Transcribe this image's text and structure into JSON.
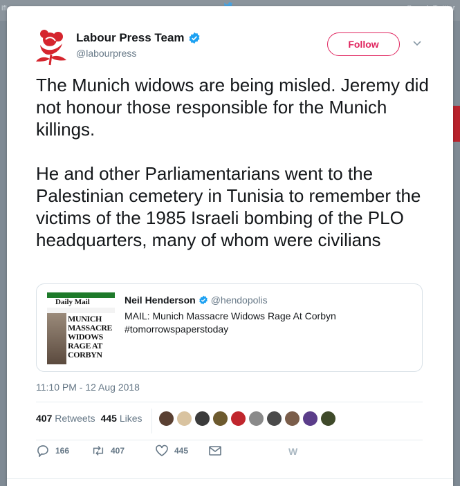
{
  "topbar": {
    "left_text": "ifi",
    "right_text": "Search Twitter"
  },
  "author": {
    "name": "Labour Press Team",
    "handle": "@labourpress"
  },
  "follow_label": "Follow",
  "tweet": {
    "paragraph1": "The Munich widows are being misled. Jeremy did not honour those responsible for the Munich killings.",
    "paragraph2": "He and other Parliamentarians went to the Palestinian cemetery in Tunisia to remember the victims of the 1985 Israeli bombing of the PLO headquarters, many of whom were civilians"
  },
  "quote": {
    "name": "Neil Henderson",
    "handle": "@hendopolis",
    "line1": "MAIL: Munich Massacre Widows Rage At Corbyn",
    "line2": "#tomorrowspaperstoday",
    "thumb_masthead": "Daily Mail",
    "thumb_headline": "MUNICH MASSACRE WIDOWS RAGE AT CORBYN"
  },
  "timestamp": "11:10 PM - 12 Aug 2018",
  "stats": {
    "retweets_count": "407",
    "retweets_label": "Retweets",
    "likes_count": "445",
    "likes_label": "Likes"
  },
  "avatar_colors": [
    "#5a4032",
    "#d9c3a0",
    "#3b3b3b",
    "#6d5a2e",
    "#c0262d",
    "#8a8a8a",
    "#4a4a4a",
    "#7a5d4a",
    "#5b3d8a",
    "#3f4a2a"
  ],
  "actions": {
    "replies": "166",
    "retweets": "407",
    "likes": "445",
    "w_icon": "W"
  },
  "colors": {
    "accent": "#e0245e",
    "brand_red": "#d5252e",
    "verified_blue": "#1da1f2"
  }
}
